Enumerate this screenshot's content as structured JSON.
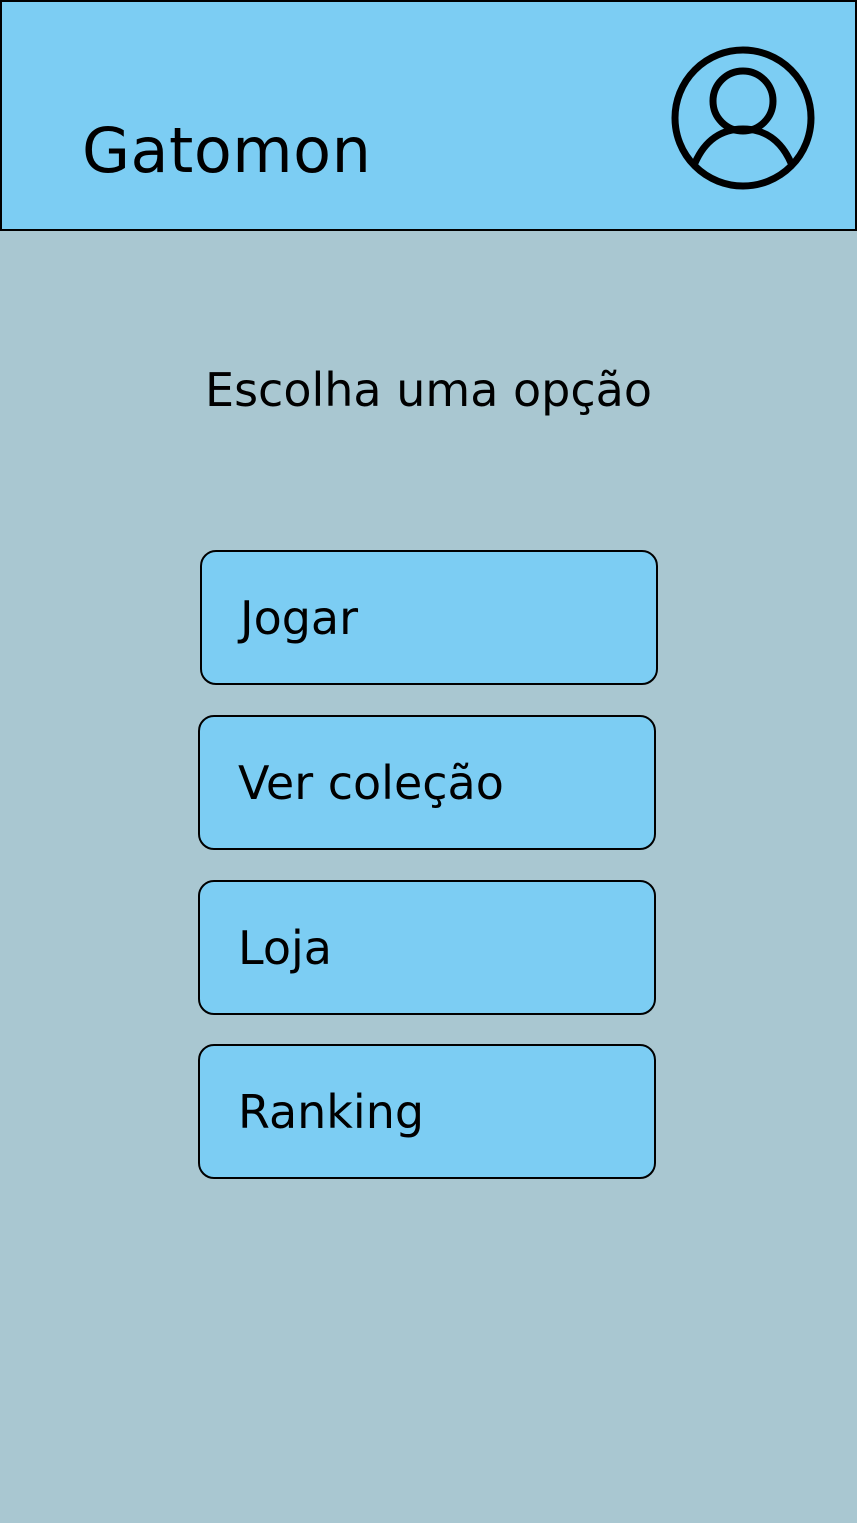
{
  "header": {
    "title": "Gatomon",
    "profile_icon": "user-circle-icon"
  },
  "main": {
    "prompt": "Escolha uma opção",
    "menu": [
      {
        "label": "Jogar"
      },
      {
        "label": "Ver coleção"
      },
      {
        "label": "Loja"
      },
      {
        "label": "Ranking"
      }
    ]
  },
  "colors": {
    "background": "#a9c7d1",
    "accent": "#7ccdf3",
    "border": "#000000"
  }
}
